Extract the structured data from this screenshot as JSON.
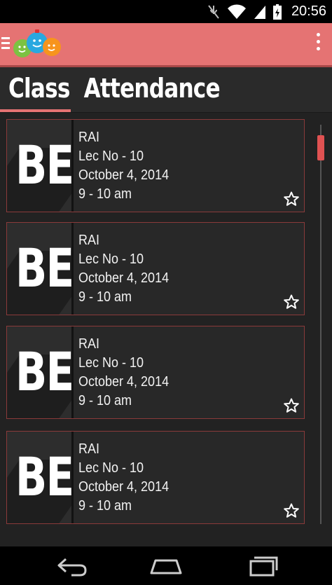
{
  "status_bar": {
    "time": "20:56",
    "icons": [
      "mute-icon",
      "wifi-icon",
      "signal-icon",
      "battery-icon"
    ]
  },
  "app_bar": {
    "background": "#e57373",
    "icons": [
      "menu-icon",
      "app-logo",
      "overflow-menu-icon"
    ]
  },
  "page": {
    "title": "Class  Attendance",
    "accent": "#e57373"
  },
  "cards": [
    {
      "badge": "BE",
      "subject": "RAI",
      "lecture": "Lec No - 10",
      "date": "October 4, 2014",
      "time": "9 - 10 am"
    },
    {
      "badge": "BE",
      "subject": "RAI",
      "lecture": "Lec No - 10",
      "date": "October 4, 2014",
      "time": "9 - 10 am"
    },
    {
      "badge": "BE",
      "subject": "RAI",
      "lecture": "Lec No - 10",
      "date": "October 4, 2014",
      "time": "9 - 10 am"
    },
    {
      "badge": "BE",
      "subject": "RAI",
      "lecture": "Lec No - 10",
      "date": "October 4, 2014",
      "time": "9 - 10 am"
    }
  ],
  "nav_bar": {
    "icons": [
      "back-icon",
      "home-icon",
      "recent-apps-icon"
    ]
  }
}
